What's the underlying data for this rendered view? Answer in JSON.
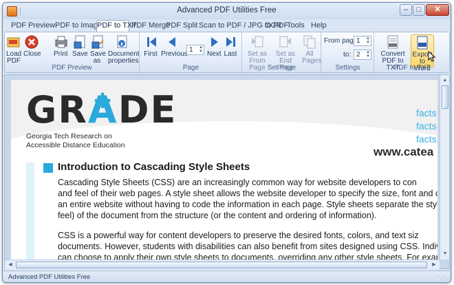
{
  "window": {
    "title": "Advanced PDF Utilities Free"
  },
  "tabs": [
    "PDF Preview",
    "PDF to Image",
    "PDF to TXT",
    "PDF Merge",
    "PDF Split",
    "Scan to PDF / JPG to PDF",
    "OCR",
    "Tools",
    "Help"
  ],
  "active_tab": "PDF to TXT",
  "ribbon": {
    "pdf_preview": {
      "label": "PDF Preview",
      "load": "Load\nPDF",
      "close": "Close",
      "print": "Print",
      "save": "Save",
      "save_as": "Save\nas",
      "properties": "Document\nproperties"
    },
    "page": {
      "label": "Page",
      "first": "First",
      "previous": "Previous",
      "page_value": "1",
      "next": "Next",
      "last": "Last"
    },
    "set_page": {
      "label": "Set Page",
      "as_from": "Set as\nFrom Page",
      "as_end": "Set as\nEnd Page",
      "all_pages": "All\nPages"
    },
    "settings": {
      "label": "Settings",
      "from_label": "From page:",
      "from_value": "1",
      "to_label": "to:",
      "to_value": "2"
    },
    "pdf_to_txt": {
      "label": "PDF to TXT",
      "convert": "Convert\nPDF to TXT",
      "export": "Export\nto Word"
    }
  },
  "document": {
    "logo_text": "GRADE",
    "logo_plus": "+",
    "logo_subtitle_1": "Georgia Tech Research on",
    "logo_subtitle_2": "Accessible Distance Education",
    "facts": [
      "facts",
      "facts",
      "facts"
    ],
    "url": "www.catea",
    "heading": "Introduction to Cascading Style Sheets",
    "paragraph_1": [
      "        Cascading Style Sheets (CSS) are an increasingly common way for website developers to con",
      "and feel of their web pages.  A style sheet allows the website developer to specify the size, font and co",
      "an entire website without having to code the information in each page.  Style sheets separate the style",
      "feel) of the document from the structure (or the content and ordering of information)."
    ],
    "paragraph_2": [
      "        CSS is a powerful way for content developers to preserve the desired fonts, colors, and text siz",
      "documents.  However, students with disabilities can also benefit from sites designed using CSS.  Indivi",
      "can choose to apply their own style sheets to documents, overriding any other style sheets.  For examp"
    ]
  },
  "status": {
    "text": "Advanced PDF Utilities Free"
  },
  "colors": {
    "accent": "#2aa9dc",
    "ribbon_bg": "#dbe6f4",
    "highlight": "#ffd769"
  }
}
